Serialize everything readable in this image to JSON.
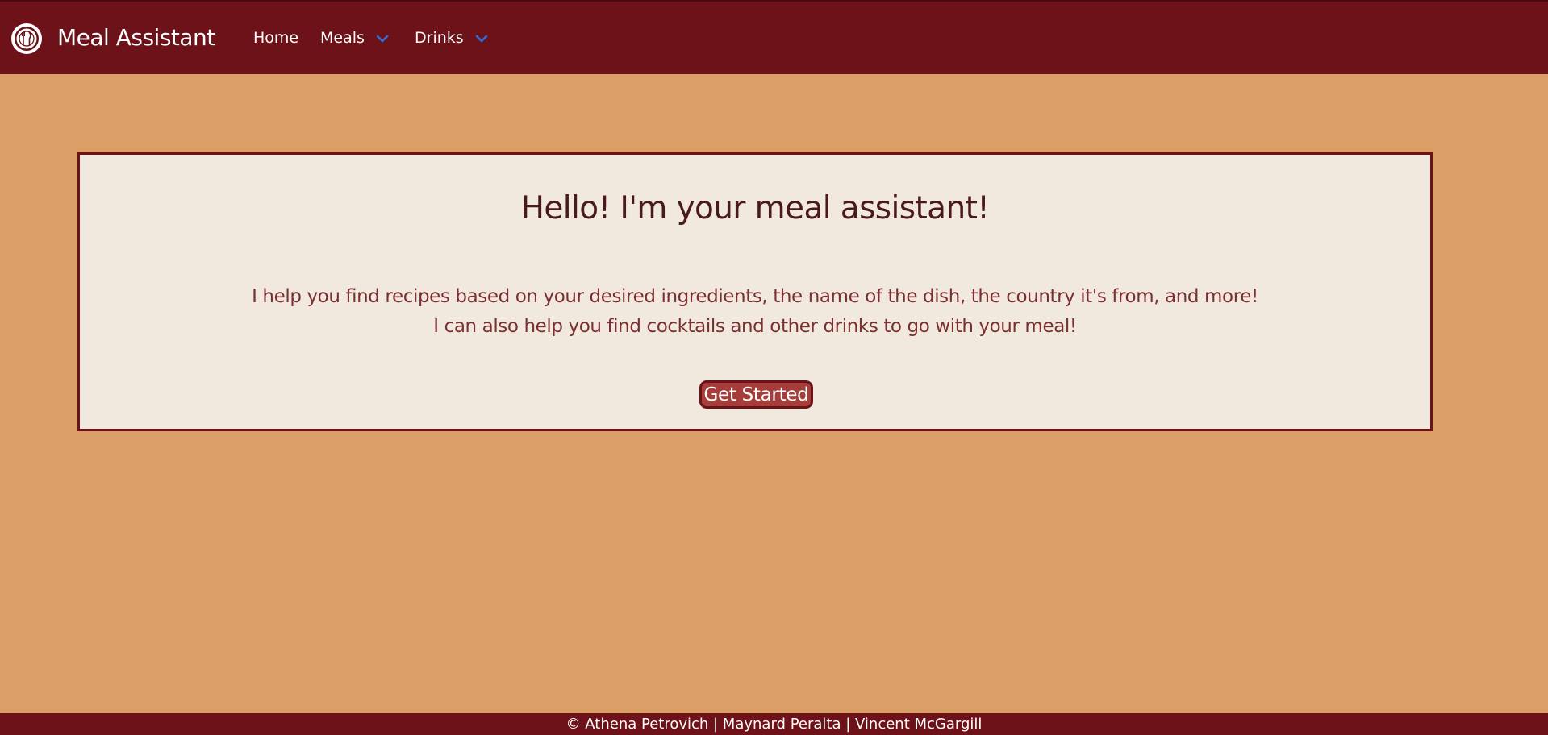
{
  "navbar": {
    "logo_icon": "fork-knife-plate-icon",
    "brand": "Meal Assistant",
    "items": [
      {
        "label": "Home"
      },
      {
        "label": "Meals",
        "icon": "chevron-down-icon"
      },
      {
        "label": "Drinks",
        "icon": "chevron-down-icon"
      }
    ],
    "colors": {
      "background": "#6c1218",
      "chevron": "#2f6fdc"
    }
  },
  "card": {
    "title": "Hello! I'm your meal assistant!",
    "line1": "I help you find recipes based on your desired ingredients, the name of the dish, the country it's from, and more!",
    "line2": "I can also help you find cocktails and other drinks to go with your meal!",
    "button_label": "Get Started"
  },
  "footer": {
    "text": "© Athena Petrovich | Maynard Peralta | Vincent McGargill"
  },
  "colors": {
    "page_background": "#db9e66",
    "card_background": "#f1e8de",
    "button": "#a53d3b"
  }
}
